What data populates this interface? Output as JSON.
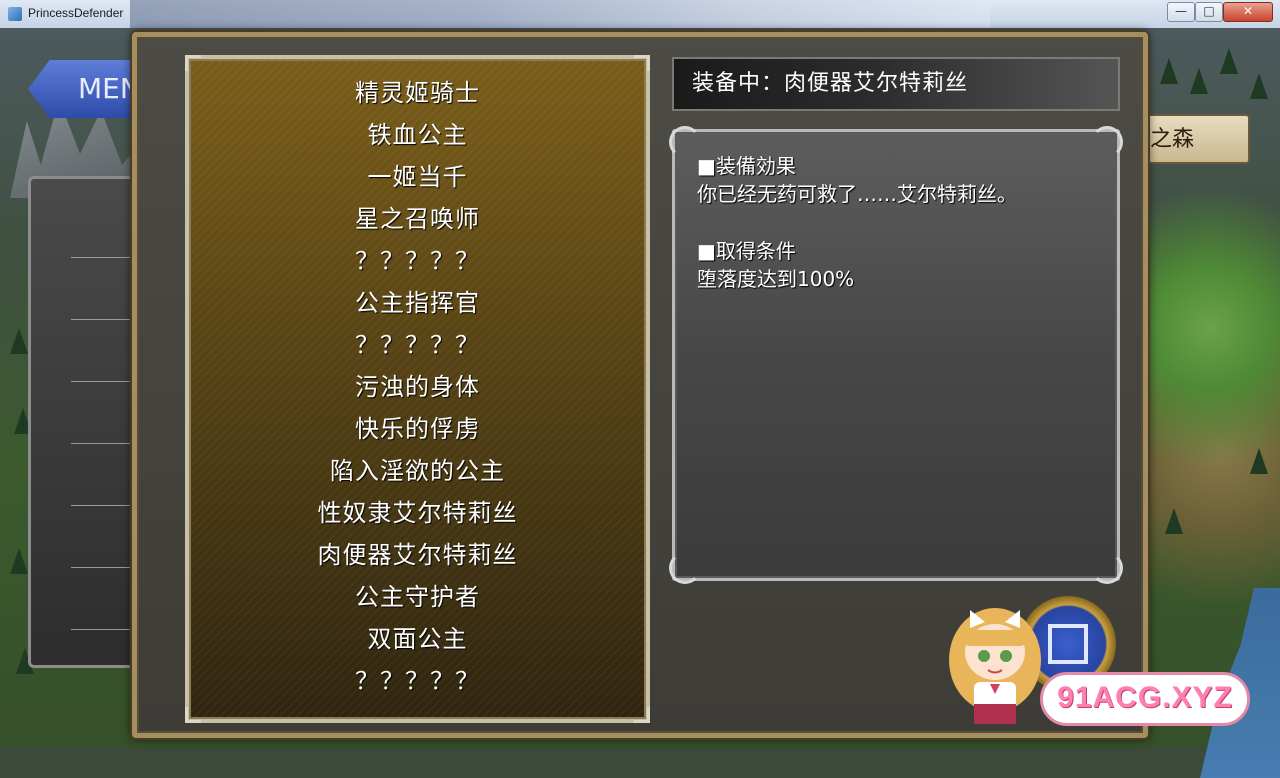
{
  "window": {
    "title": "PrincessDefender",
    "minimize": "—",
    "maximize": "□",
    "close": "✕"
  },
  "background": {
    "menu_label": "MEN",
    "map_label": "之森"
  },
  "title_list": {
    "items": [
      "精灵姬骑士",
      "铁血公主",
      "一姬当千",
      "星之召唤师",
      "？？？？？",
      "公主指挥官",
      "？？？？？",
      "污浊的身体",
      "快乐的俘虏",
      "陷入淫欲的公主",
      "性奴隶艾尔特莉丝",
      "肉便器艾尔特莉丝",
      "公主守护者",
      "双面公主",
      "？？？？？"
    ]
  },
  "equipped": {
    "text": "装备中：肉便器艾尔特莉丝"
  },
  "description": {
    "effect_heading": "■装備効果",
    "effect_text": "你已经无药可救了……艾尔特莉丝。",
    "condition_heading": "■取得条件",
    "condition_text": "堕落度达到100%"
  },
  "watermark": {
    "text": "91ACG.XYZ"
  }
}
